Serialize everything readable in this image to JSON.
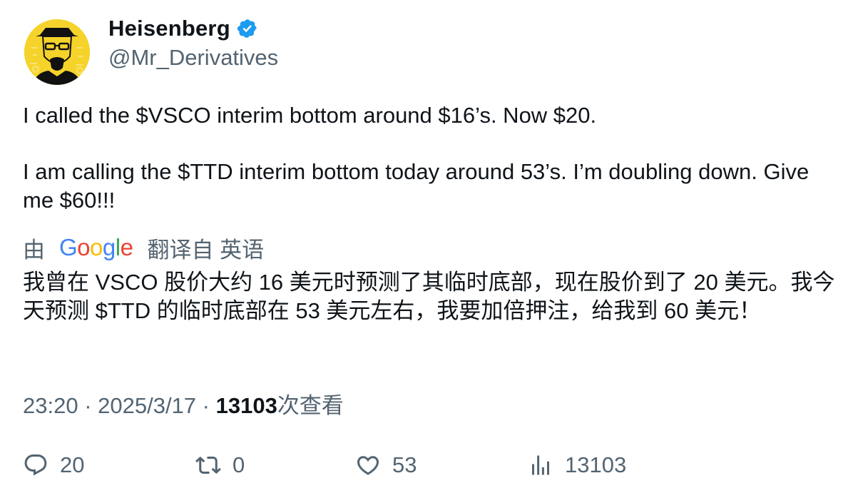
{
  "author": {
    "name": "Heisenberg",
    "handle": "@Mr_Derivatives",
    "verified_color": "#1d9bf0"
  },
  "post": {
    "paragraphs": [
      "I called the $VSCO interim bottom around $16’s. Now $20.",
      "I am calling the $TTD interim bottom today around 53’s. I’m doubling down. Give me $60!!!"
    ]
  },
  "translation": {
    "prefix": "由",
    "provider": "Google",
    "suffix": "翻译自 英语",
    "text": "我曾在 VSCO 股价大约 16 美元时预测了其临时底部，现在股价到了 20 美元。我今天预测 $TTD 的临时底部在 53 美元左右，我要加倍押注，给我到 60 美元！"
  },
  "meta": {
    "time": "23:20",
    "sep1": " · ",
    "date": "2025/3/17",
    "sep2": " · ",
    "views": "13103",
    "views_label": "次查看"
  },
  "actions": {
    "replies": "20",
    "reposts": "0",
    "likes": "53",
    "views": "13103"
  },
  "icons": [
    "verified-badge-icon",
    "reply-icon",
    "repost-icon",
    "like-icon",
    "views-chart-icon"
  ]
}
